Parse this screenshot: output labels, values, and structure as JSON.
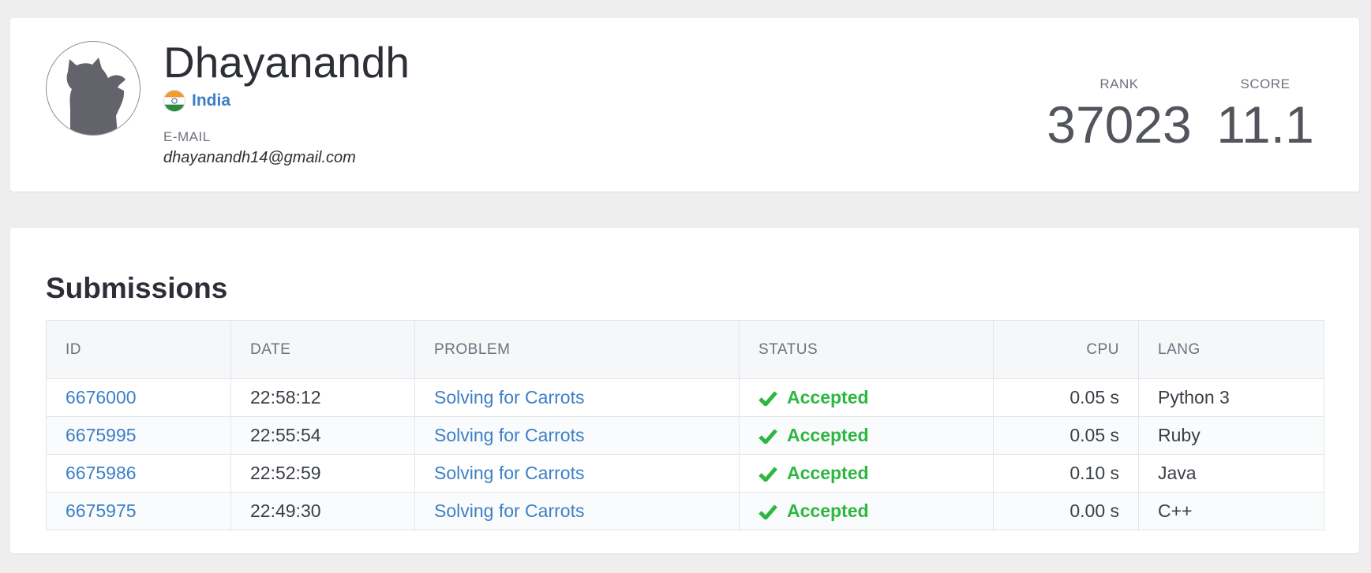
{
  "profile": {
    "name": "Dhayanandh",
    "country": "India",
    "email_label": "E-MAIL",
    "email": "dhayanandh14@gmail.com",
    "rank_label": "RANK",
    "rank": "37023",
    "score_label": "SCORE",
    "score": "11.1"
  },
  "submissions": {
    "title": "Submissions",
    "columns": [
      "ID",
      "DATE",
      "PROBLEM",
      "STATUS",
      "CPU",
      "LANG"
    ],
    "rows": [
      {
        "id": "6676000",
        "date": "22:58:12",
        "problem": "Solving for Carrots",
        "status": "Accepted",
        "cpu": "0.05 s",
        "lang": "Python 3"
      },
      {
        "id": "6675995",
        "date": "22:55:54",
        "problem": "Solving for Carrots",
        "status": "Accepted",
        "cpu": "0.05 s",
        "lang": "Ruby"
      },
      {
        "id": "6675986",
        "date": "22:52:59",
        "problem": "Solving for Carrots",
        "status": "Accepted",
        "cpu": "0.10 s",
        "lang": "Java"
      },
      {
        "id": "6675975",
        "date": "22:49:30",
        "problem": "Solving for Carrots",
        "status": "Accepted",
        "cpu": "0.00 s",
        "lang": "C++"
      }
    ]
  },
  "colors": {
    "link": "#3d7fc6",
    "accepted": "#2db742",
    "background": "#eeeeee"
  },
  "icons": {
    "avatar": "default-cat-avatar",
    "flag": "india-flag-icon",
    "status": "checkmark-icon"
  }
}
